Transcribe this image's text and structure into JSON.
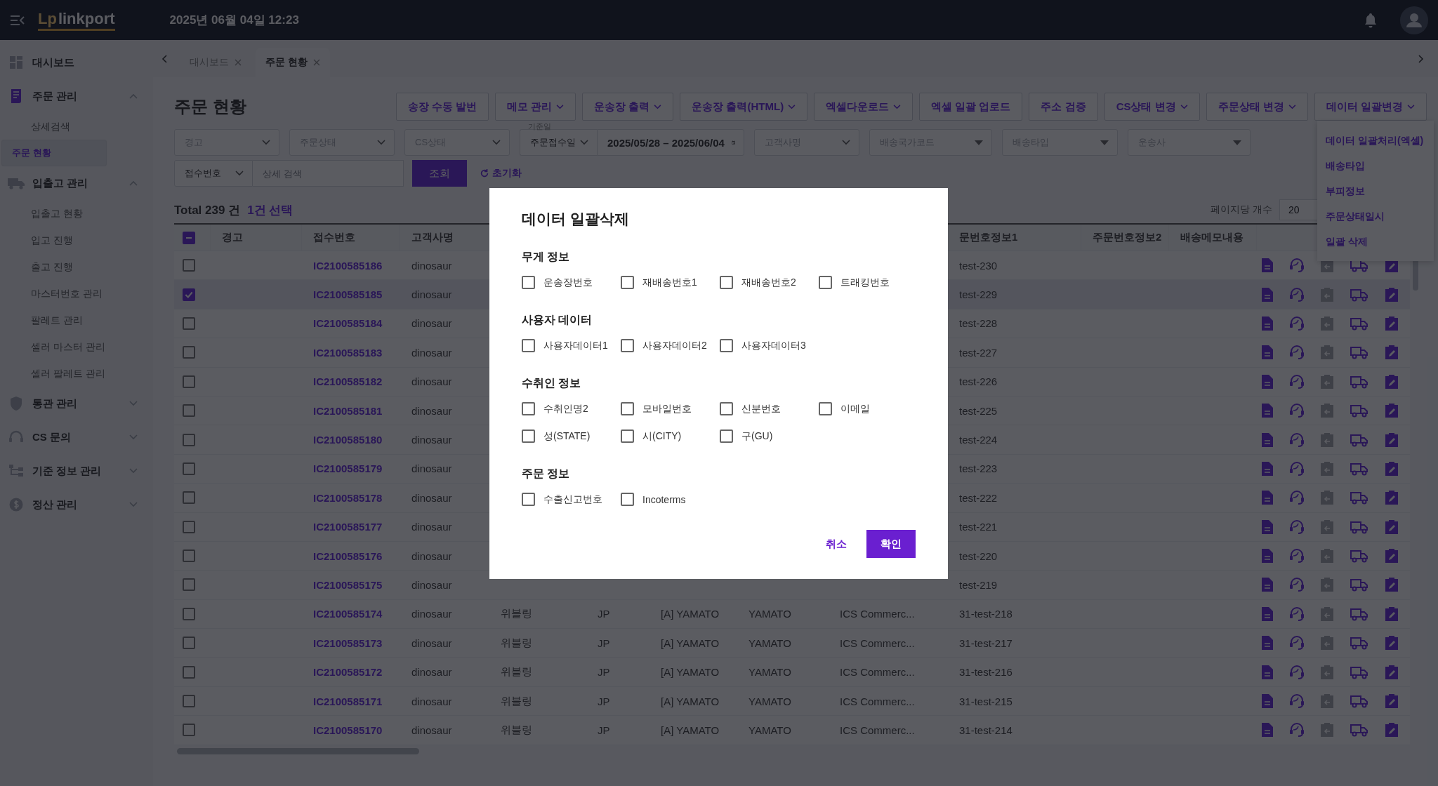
{
  "header": {
    "logo": {
      "mark": "Lp",
      "name": "linkport"
    },
    "date": "2025년 06월 04일 12:23"
  },
  "sidebar": [
    {
      "label": "대시보드"
    },
    {
      "label": "주문 관리",
      "expanded": true,
      "children": [
        {
          "label": "상세검색",
          "selected": false
        },
        {
          "label": "주문 현황",
          "selected": true
        }
      ]
    },
    {
      "label": "입출고 관리",
      "expanded": true,
      "children": [
        {
          "label": "입출고 현황",
          "selected": false
        },
        {
          "label": "입고 진행",
          "selected": false
        },
        {
          "label": "출고 진행",
          "selected": false
        },
        {
          "label": "마스터번호 관리",
          "selected": false
        },
        {
          "label": "팔레트 관리",
          "selected": false
        },
        {
          "label": "셀러 마스터 관리",
          "selected": false
        },
        {
          "label": "셀러 팔레트 관리",
          "selected": false
        }
      ]
    },
    {
      "label": "통관 관리",
      "expanded": false
    },
    {
      "label": "CS 문의",
      "expanded": false
    },
    {
      "label": "기준 정보 관리",
      "expanded": false
    },
    {
      "label": "정산 관리",
      "expanded": false
    }
  ],
  "tabs": [
    {
      "label": "대시보드",
      "selected": false
    },
    {
      "label": "주문 현황",
      "selected": true
    }
  ],
  "page_title": "주문 현황",
  "toolbar": [
    {
      "label": "송장 수동 발번",
      "dropdown": false
    },
    {
      "label": "메모 관리",
      "dropdown": true
    },
    {
      "label": "운송장 출력",
      "dropdown": true
    },
    {
      "label": "운송장 출력(HTML)",
      "dropdown": true
    },
    {
      "label": "엑셀다운로드",
      "dropdown": true
    },
    {
      "label": "엑셀 일괄 업로드",
      "dropdown": false
    },
    {
      "label": "주소 검증",
      "dropdown": false
    },
    {
      "label": "CS상태 변경",
      "dropdown": true
    },
    {
      "label": "주문상태 변경",
      "dropdown": true
    },
    {
      "label": "데이터 일괄변경",
      "dropdown": true
    }
  ],
  "dropdown_menu": [
    "데이터 일괄처리(엑셀)",
    "배송타입",
    "부피정보",
    "주문상태일시",
    "일괄 삭제"
  ],
  "filters": [
    {
      "kind": "select",
      "placeholder": "경고"
    },
    {
      "kind": "select",
      "placeholder": "주문상태"
    },
    {
      "kind": "select",
      "placeholder": "CS상태"
    },
    {
      "kind": "date_type",
      "label": "기준일",
      "value": "주문접수일"
    },
    {
      "kind": "date",
      "value": "2025/05/28 – 2025/06/04"
    },
    {
      "kind": "select",
      "placeholder": "고객사명"
    },
    {
      "kind": "combo",
      "placeholder": "배송국가코드"
    },
    {
      "kind": "combo",
      "placeholder": "배송타입"
    },
    {
      "kind": "combo",
      "placeholder": "운송사"
    }
  ],
  "search": {
    "field": "접수번호",
    "placeholder": "상세 검색",
    "button": "조회",
    "reset": "초기화"
  },
  "summary": {
    "total": "Total 239 건",
    "selected": "1건 선택",
    "page_size_label": "페이지당 개수",
    "page_size": "20"
  },
  "table": {
    "select_all": {
      "indeterminate": true
    },
    "left_columns": [
      "경고",
      "접수번호",
      "고객사명"
    ],
    "right_columns": [
      "문번호정보1",
      "주문번호정보2",
      "배송메모내용"
    ],
    "rows": [
      {
        "selected": false,
        "receipt_no": "IC2100585186",
        "customer": "dinosaur",
        "order_info_1": "test-230"
      },
      {
        "selected": true,
        "receipt_no": "IC2100585185",
        "customer": "dinosaur",
        "order_info_1": "test-229"
      },
      {
        "selected": false,
        "receipt_no": "IC2100585184",
        "customer": "dinosaur",
        "order_info_1": "test-228"
      },
      {
        "selected": false,
        "receipt_no": "IC2100585183",
        "customer": "dinosaur",
        "order_info_1": "test-227"
      },
      {
        "selected": false,
        "receipt_no": "IC2100585182",
        "customer": "dinosaur",
        "order_info_1": "test-226"
      },
      {
        "selected": false,
        "receipt_no": "IC2100585181",
        "customer": "dinosaur",
        "order_info_1": "test-225"
      },
      {
        "selected": false,
        "receipt_no": "IC2100585180",
        "customer": "dinosaur",
        "order_info_1": "test-224"
      },
      {
        "selected": false,
        "receipt_no": "IC2100585179",
        "customer": "dinosaur",
        "order_info_1": "test-223"
      },
      {
        "selected": false,
        "receipt_no": "IC2100585178",
        "customer": "dinosaur",
        "order_info_1": "test-222"
      },
      {
        "selected": false,
        "receipt_no": "IC2100585177",
        "customer": "dinosaur",
        "order_info_1": "test-221"
      },
      {
        "selected": false,
        "receipt_no": "IC2100585176",
        "customer": "dinosaur",
        "order_info_1": "test-220"
      },
      {
        "selected": false,
        "receipt_no": "IC2100585175",
        "customer": "dinosaur",
        "order_info_1": "test-219"
      },
      {
        "selected": false,
        "receipt_no": "IC2100585174",
        "customer": "dinosaur",
        "cells": [
          "위블링",
          "JP",
          "[A] YAMATO",
          "YAMATO",
          "ICS Commerc..."
        ],
        "order_info_1": "31-test-218"
      },
      {
        "selected": false,
        "receipt_no": "IC2100585173",
        "customer": "dinosaur",
        "cells": [
          "위블링",
          "JP",
          "[A] YAMATO",
          "YAMATO",
          "ICS Commerc..."
        ],
        "order_info_1": "31-test-217"
      },
      {
        "selected": false,
        "receipt_no": "IC2100585172",
        "customer": "dinosaur",
        "cells": [
          "위블링",
          "JP",
          "[A] YAMATO",
          "YAMATO",
          "ICS Commerc..."
        ],
        "order_info_1": "31-test-216"
      },
      {
        "selected": false,
        "receipt_no": "IC2100585171",
        "customer": "dinosaur",
        "cells": [
          "위블링",
          "JP",
          "[A] YAMATO",
          "YAMATO",
          "ICS Commerc..."
        ],
        "order_info_1": "31-test-215"
      },
      {
        "selected": false,
        "receipt_no": "IC2100585170",
        "customer": "dinosaur",
        "cells": [
          "위블링",
          "JP",
          "[A] YAMATO",
          "YAMATO",
          "ICS Commerc..."
        ],
        "order_info_1": "31-test-214"
      }
    ]
  },
  "modal": {
    "title": "데이터 일괄삭제",
    "sections": [
      {
        "title": "무게 정보",
        "options": [
          {
            "label": "운송장번호",
            "checked": false
          },
          {
            "label": "재배송번호1",
            "checked": false
          },
          {
            "label": "재배송번호2",
            "checked": false
          },
          {
            "label": "트래킹번호",
            "checked": false
          }
        ]
      },
      {
        "title": "사용자 데이터",
        "options": [
          {
            "label": "사용자데이터1",
            "checked": false
          },
          {
            "label": "사용자데이터2",
            "checked": false
          },
          {
            "label": "사용자데이터3",
            "checked": false
          }
        ]
      },
      {
        "title": "수취인 정보",
        "options": [
          {
            "label": "수취인명2",
            "checked": false
          },
          {
            "label": "모바일번호",
            "checked": false
          },
          {
            "label": "신분번호",
            "checked": false
          },
          {
            "label": "이메일",
            "checked": false
          },
          {
            "label": "성(STATE)",
            "checked": false
          },
          {
            "label": "시(CITY)",
            "checked": false
          },
          {
            "label": "구(GU)",
            "checked": false
          }
        ]
      },
      {
        "title": "주문 정보",
        "options": [
          {
            "label": "수출신고번호",
            "checked": false
          },
          {
            "label": "Incoterms",
            "checked": false
          }
        ]
      }
    ],
    "cancel": "취소",
    "confirm": "확인"
  }
}
